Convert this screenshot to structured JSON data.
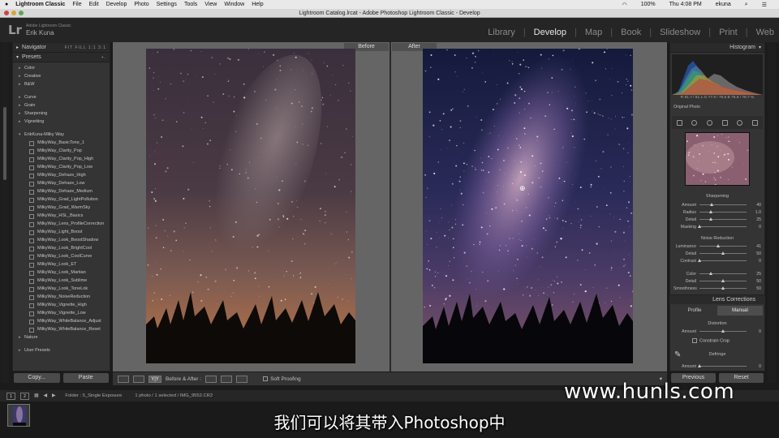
{
  "menubar": {
    "items": [
      "Lightroom Classic",
      "File",
      "Edit",
      "Develop",
      "Photo",
      "Settings",
      "Tools",
      "View",
      "Window",
      "Help"
    ],
    "battery": "100%",
    "clock": "Thu 4:08 PM",
    "user": "ekuna"
  },
  "window_title": "Lightroom Catalog.lrcat - Adobe Photoshop Lightroom Classic - Develop",
  "identity": {
    "logo": "Lr",
    "product": "Adobe Lightroom Classic",
    "user": "Erik Kuna"
  },
  "modules": [
    "Library",
    "Develop",
    "Map",
    "Book",
    "Slideshow",
    "Print",
    "Web"
  ],
  "active_module": "Develop",
  "left_panel": {
    "navigator": {
      "title": "Navigator",
      "zoom_options": "FIT   FILL   1:1   3:1"
    },
    "presets": {
      "title": "Presets",
      "add": "+.",
      "group1": [
        "Color",
        "Creative",
        "B&W"
      ],
      "group2": [
        "Curve",
        "Grain",
        "Sharpening",
        "Vignetting"
      ],
      "open_folder": "ErikKuna-Milky Way",
      "items": [
        "MilkyWay_BasicTone_1",
        "MilkyWay_Clarity_Pop",
        "MilkyWay_Clarity_Pop_High",
        "MilkyWay_Clarity_Pop_Low",
        "MilkyWay_Dehaze_High",
        "MilkyWay_Dehaze_Low",
        "MilkyWay_Dehaze_Medium",
        "MilkyWay_Grad_LightPollution",
        "MilkyWay_Grad_WarmSky",
        "MilkyWay_HSL_Basics",
        "MilkyWay_Lens_ProfileCorrection",
        "MilkyWay_Light_Boost",
        "MilkyWay_Look_BoostShadow",
        "MilkyWay_Look_BrightCool",
        "MilkyWay_Look_CoolCurve",
        "MilkyWay_Look_ET",
        "MilkyWay_Look_Martian",
        "MilkyWay_Look_Sublime",
        "MilkyWay_Look_ToneLok",
        "MilkyWay_NoiseReduction",
        "MilkyWay_Vignette_High",
        "MilkyWay_Vignette_Low",
        "MilkyWay_WhiteBalance_Adjust",
        "MilkyWay_WhiteBalance_Reset"
      ],
      "after_folders": [
        "Nature"
      ],
      "user_presets": "User Presets"
    },
    "copy_button": "Copy...",
    "paste_button": "Paste"
  },
  "view": {
    "before_label": "Before",
    "after_label": "After"
  },
  "toolbar": {
    "view_mode": "Y|Y",
    "before_after": "Before & After :",
    "soft_proofing": "Soft Proofing"
  },
  "right_panel": {
    "histogram_title": "Histogram",
    "histogram_readout": "R  81.7 / 81.1  G  77.9 / 78.6  B  75.8 / 78.7 %",
    "original_photo": "Original Photo",
    "sharpening": {
      "title": "Sharpening",
      "sliders": [
        {
          "label": "Amount",
          "value": "40",
          "level": 0.27
        },
        {
          "label": "Radius",
          "value": "1.0",
          "level": 0.25
        },
        {
          "label": "Detail",
          "value": "25",
          "level": 0.25
        },
        {
          "label": "Masking",
          "value": "0",
          "level": 0.0
        }
      ]
    },
    "noise_reduction": {
      "title": "Noise Reduction",
      "sliders": [
        {
          "label": "Luminance",
          "value": "41",
          "level": 0.41
        },
        {
          "label": "Detail",
          "value": "50",
          "level": 0.5
        },
        {
          "label": "Contrast",
          "value": "0",
          "level": 0.0
        },
        {
          "label": "Color",
          "value": "25",
          "level": 0.25
        },
        {
          "label": "Detail",
          "value": "50",
          "level": 0.5
        },
        {
          "label": "Smoothness",
          "value": "50",
          "level": 0.5
        }
      ]
    },
    "lens_corrections": {
      "title": "Lens Corrections",
      "tabs": [
        "Profile",
        "Manual"
      ],
      "active_tab": "Manual",
      "distortion_title": "Distortion",
      "distortion": {
        "label": "Amount",
        "value": "0",
        "level": 0.5
      },
      "constrain_crop": "Constrain Crop",
      "defringe_title": "Defringe",
      "defringe": {
        "label": "Amount",
        "value": "0",
        "level": 0.0
      }
    },
    "previous_button": "Previous",
    "reset_button": "Reset"
  },
  "filmstrip": {
    "pages": [
      "1",
      "2"
    ],
    "path": "Folder : 5_Single Exposure",
    "info": "1 photo / 1 selected / IMG_9552.CR2"
  },
  "subtitle": "我们可以将其带入Photoshop中",
  "watermark": "www.hunls.com",
  "colors": {
    "panel": "#343434",
    "center": "#656565",
    "accent_active": "#e8e8e8"
  }
}
